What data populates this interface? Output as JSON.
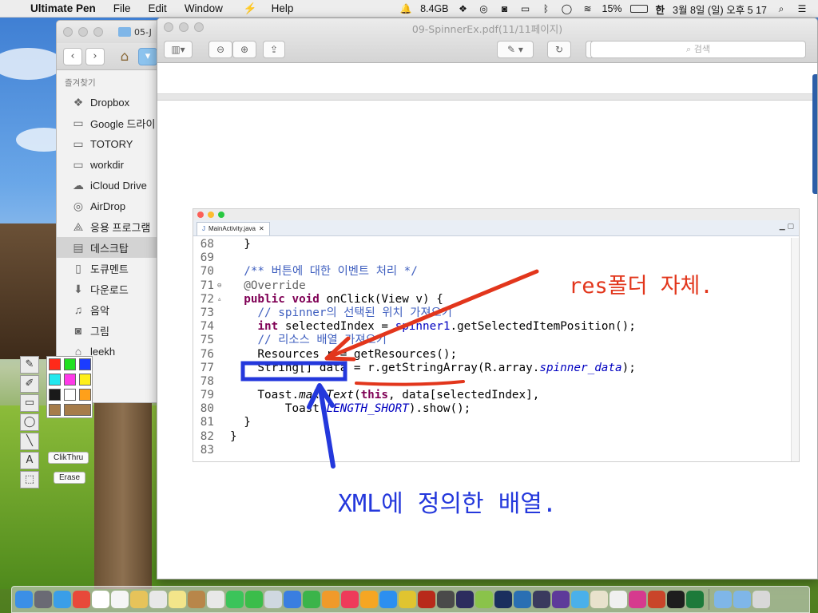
{
  "menubar": {
    "app_name": "Ultimate Pen",
    "menus": [
      "File",
      "Edit",
      "Window",
      "Help"
    ],
    "memory": "8.4GB",
    "battery": "15%",
    "input_lang": "한",
    "datetime": "3월 8일 (일) 오후  5 17"
  },
  "finder": {
    "tab_title": "05-J",
    "sidebar_heading": "즐겨찾기",
    "items": [
      {
        "label": "Dropbox",
        "icon": "dropbox-icon"
      },
      {
        "label": "Google 드라이",
        "icon": "folder-icon"
      },
      {
        "label": "TOTORY",
        "icon": "folder-icon"
      },
      {
        "label": "workdir",
        "icon": "folder-icon"
      },
      {
        "label": "iCloud Drive",
        "icon": "cloud-icon"
      },
      {
        "label": "AirDrop",
        "icon": "airdrop-icon"
      },
      {
        "label": "응용 프로그램",
        "icon": "apps-icon"
      },
      {
        "label": "데스크탑",
        "icon": "desktop-icon"
      },
      {
        "label": "도큐멘트",
        "icon": "document-icon"
      },
      {
        "label": "다운로드",
        "icon": "download-icon"
      },
      {
        "label": "음악",
        "icon": "music-icon"
      },
      {
        "label": "그림",
        "icon": "camera-icon"
      },
      {
        "label": "leekh",
        "icon": "home-icon"
      }
    ]
  },
  "preview": {
    "title": "09-SpinnerEx.pdf(11/11페이지)",
    "search_placeholder": "검색"
  },
  "eclipse": {
    "tab_label": "MainActivity.java",
    "lines": [
      {
        "n": "68",
        "marker": "",
        "html": "  }"
      },
      {
        "n": "69",
        "marker": "",
        "html": ""
      },
      {
        "n": "70",
        "marker": "",
        "html": "  <span class='cm'>/** 버튼에 대한 이벤트 처리 */</span>"
      },
      {
        "n": "71",
        "marker": "⊖",
        "html": "  <span style='color:#646464'>@Override</span>"
      },
      {
        "n": "72",
        "marker": "▵",
        "html": "  <span class='kw'>public void</span> onClick(View v) {"
      },
      {
        "n": "73",
        "marker": "",
        "html": "    <span class='cm'>// spinner의 선택된 위치 가져오기</span>"
      },
      {
        "n": "74",
        "marker": "",
        "html": "    <span class='kw'>int</span> selectedIndex = <span class='fld'>spinner1</span>.getSelectedItemPosition();"
      },
      {
        "n": "75",
        "marker": "",
        "html": "    <span class='cm'>// 리소스 배열 가져오기</span>"
      },
      {
        "n": "76",
        "marker": "",
        "html": "    Resources r = getResources();"
      },
      {
        "n": "77",
        "marker": "",
        "html": "    String[] data = r.getStringArray(R.array.<span class='fld it'>spinner_data</span>);"
      },
      {
        "n": "78",
        "marker": "",
        "html": ""
      },
      {
        "n": "79",
        "marker": "",
        "html": "    Toast.<span class='it'>makeText</span>(<span class='kw'>this</span>, data[selectedIndex],"
      },
      {
        "n": "80",
        "marker": "",
        "html": "        Toast.<span class='fld it'>LENGTH_SHORT</span>).show();"
      },
      {
        "n": "81",
        "marker": "",
        "html": "  }"
      },
      {
        "n": "82",
        "marker": "",
        "html": "}"
      },
      {
        "n": "83",
        "marker": "",
        "html": ""
      }
    ]
  },
  "annotations": {
    "red_note": "res폴더 자체.",
    "blue_note": "XML에 정의한 배열."
  },
  "palette": {
    "clickthru_label": "ClikThru",
    "erase_label": "Erase",
    "swatch_colors": [
      "#ff2a1a",
      "#22e022",
      "#1b3cff",
      "#22e8ee",
      "#ff3ae8",
      "#ffef1a",
      "#1a1a1a",
      "#ffffff",
      "#ffa01a",
      "#a67c4a",
      "#a67c4a"
    ]
  },
  "dock": {
    "apps": [
      "finder-icon",
      "launchpad-icon",
      "safari-icon",
      "chrome-icon",
      "calendar-icon",
      "reminders-icon",
      "notes-icon",
      "clock-icon",
      "stickies-icon",
      "contacts-icon",
      "photos-icon",
      "messages-icon",
      "facetime-icon",
      "preview-icon",
      "keynote-icon",
      "numbers-icon",
      "pages-icon",
      "itunes-icon",
      "ibooks-icon",
      "appstore-icon",
      "ultimatepen-icon",
      "filezilla-icon",
      "sublime-icon",
      "eclipse-icon",
      "android-icon",
      "photoshop-icon",
      "scrivener-icon",
      "database-icon",
      "vm-icon",
      "checkmark-icon",
      "paper-icon",
      "ai-icon",
      "chat-icon",
      "powerpoint-icon",
      "terminal-icon",
      "excel-icon",
      "folder-icon",
      "folder2-icon",
      "trash-icon"
    ]
  }
}
